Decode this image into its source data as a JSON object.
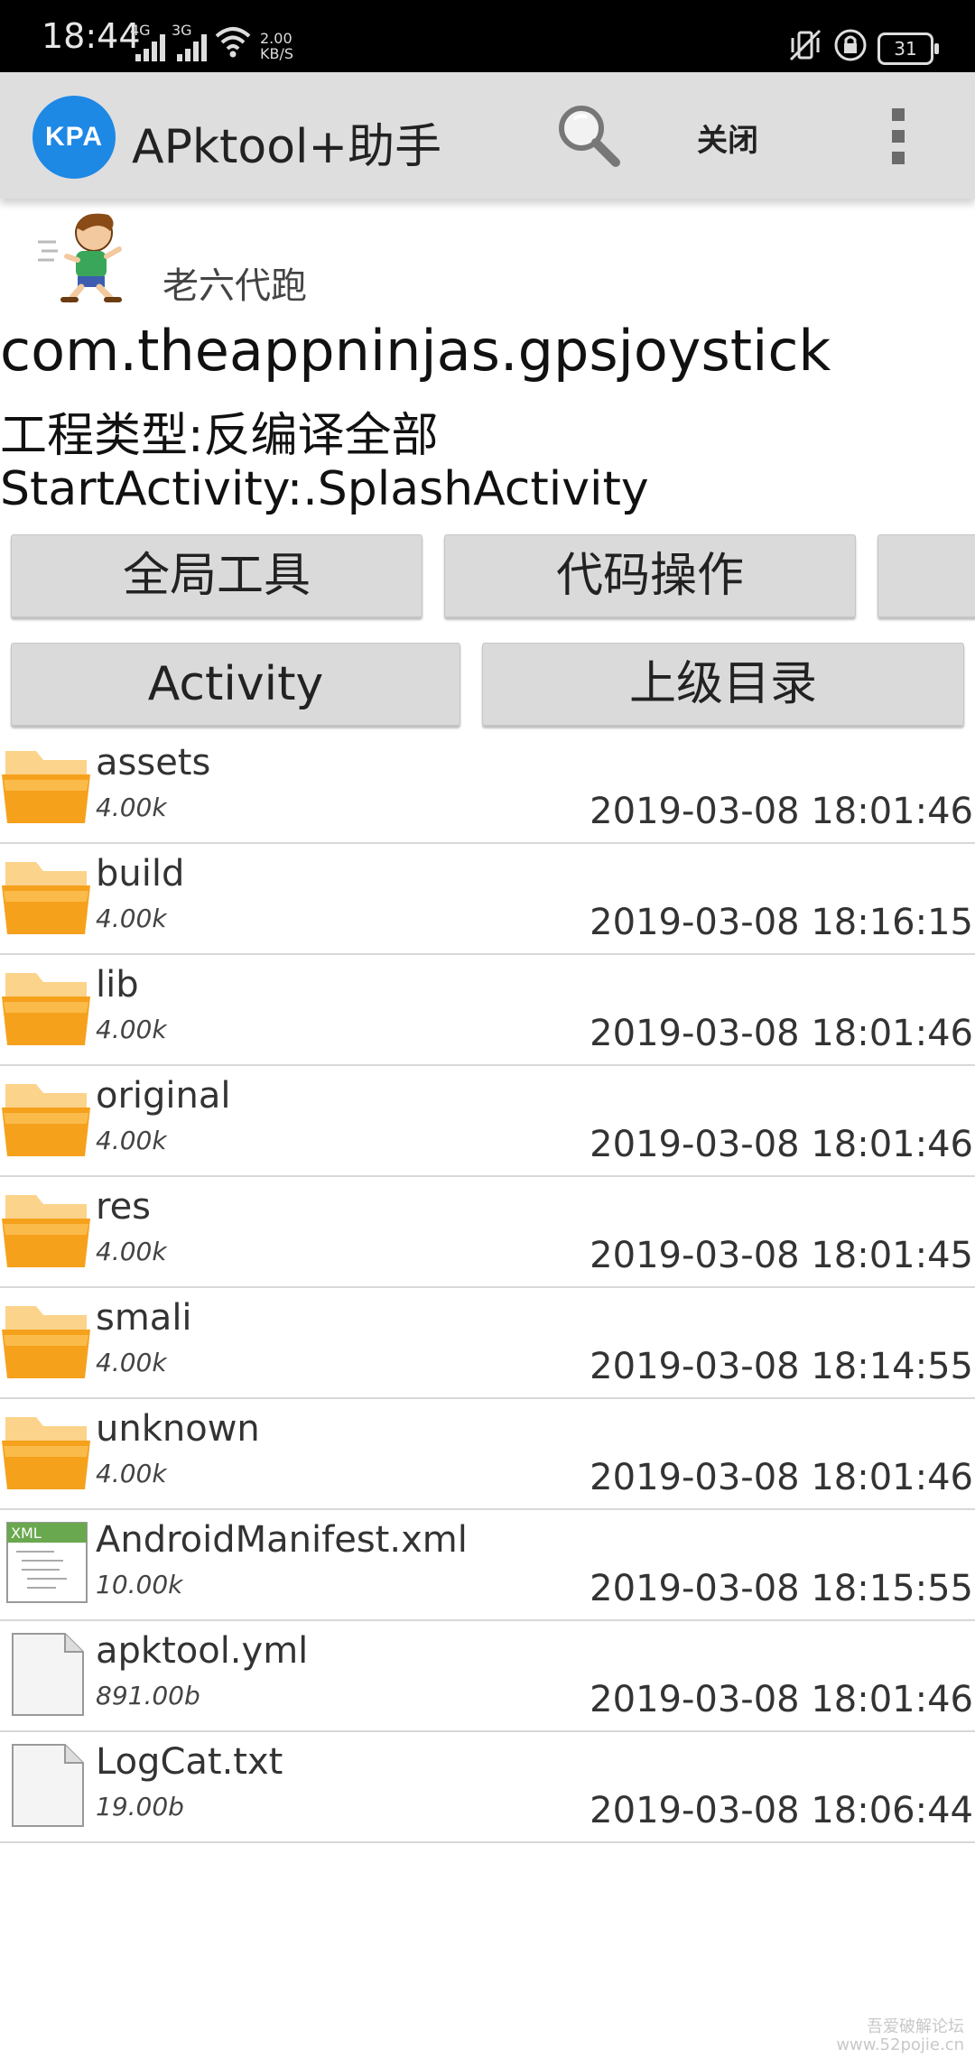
{
  "status_bar": {
    "time": "18:44",
    "net1": "4G",
    "net2": "3G",
    "speed_value": "2.00",
    "speed_unit": "KB/S",
    "battery": "31"
  },
  "toolbar": {
    "logo_text": "KPA",
    "title": "APktool+助手",
    "close_label": "关闭"
  },
  "project": {
    "author": "老六代跑",
    "package": "com.theappninjas.gpsjoystick",
    "type": "工程类型:反编译全部",
    "start_activity": "StartActivity:.SplashActivity"
  },
  "buttons": {
    "global_tools": "全局工具",
    "code_ops": "代码操作",
    "activity": "Activity",
    "parent_dir": "上级目录"
  },
  "files": [
    {
      "name": "assets",
      "size": "4.00k",
      "date": "2019-03-08 18:01:46",
      "kind": "folder"
    },
    {
      "name": "build",
      "size": "4.00k",
      "date": "2019-03-08 18:16:15",
      "kind": "folder"
    },
    {
      "name": "lib",
      "size": "4.00k",
      "date": "2019-03-08 18:01:46",
      "kind": "folder"
    },
    {
      "name": "original",
      "size": "4.00k",
      "date": "2019-03-08 18:01:46",
      "kind": "folder"
    },
    {
      "name": "res",
      "size": "4.00k",
      "date": "2019-03-08 18:01:45",
      "kind": "folder"
    },
    {
      "name": "smali",
      "size": "4.00k",
      "date": "2019-03-08 18:14:55",
      "kind": "folder"
    },
    {
      "name": "unknown",
      "size": "4.00k",
      "date": "2019-03-08 18:01:46",
      "kind": "folder"
    },
    {
      "name": "AndroidManifest.xml",
      "size": "10.00k",
      "date": "2019-03-08 18:15:55",
      "kind": "xml"
    },
    {
      "name": "apktool.yml",
      "size": "891.00b",
      "date": "2019-03-08 18:01:46",
      "kind": "file"
    },
    {
      "name": "LogCat.txt",
      "size": "19.00b",
      "date": "2019-03-08 18:06:44",
      "kind": "file"
    }
  ],
  "icons": {
    "folder": "folder-icon",
    "xml": "xml-file-icon",
    "file": "file-icon"
  },
  "colors": {
    "brand": "#1e88e5",
    "folder": "#f5a11c",
    "toolbar_bg": "#dedede"
  },
  "watermark": {
    "line1": "吾爱破解论坛",
    "line2": "www.52pojie.cn"
  }
}
